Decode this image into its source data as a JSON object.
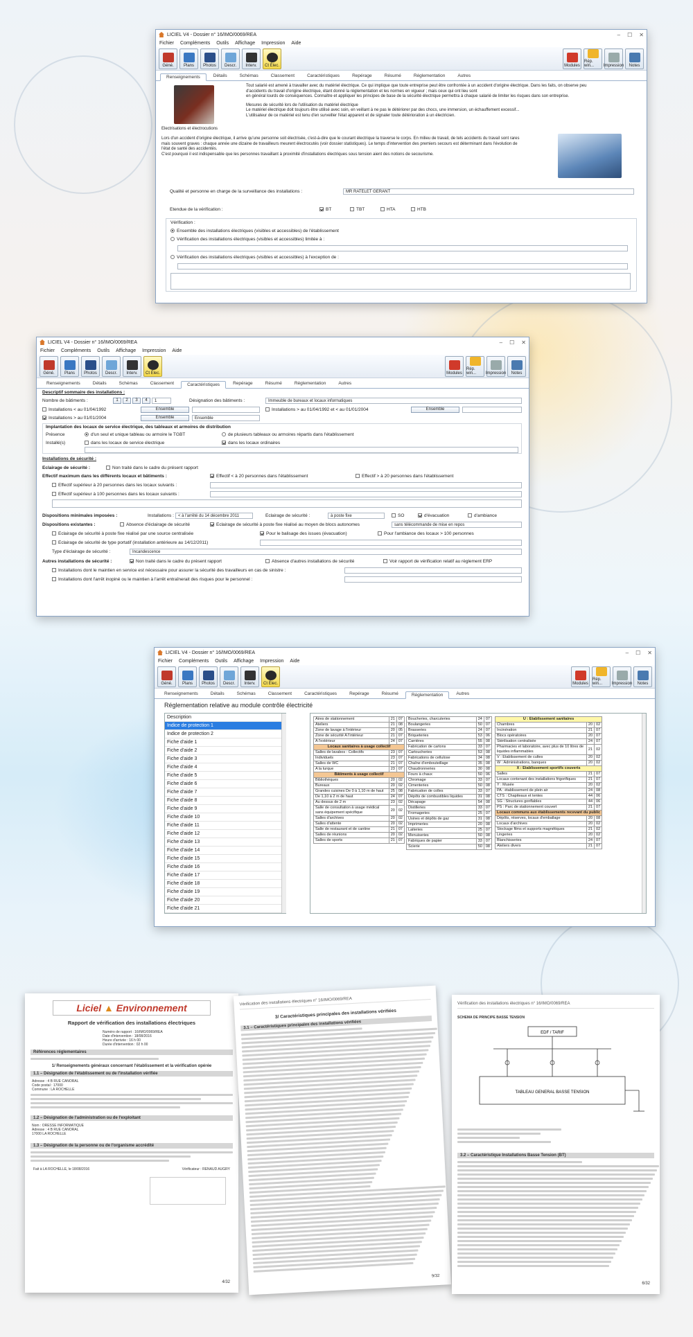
{
  "app": {
    "title": "LICIEL V4 - Dossier n° 16/IMO/0069/REA",
    "menu": [
      "Fichier",
      "Compléments",
      "Outils",
      "Affichage",
      "Impression",
      "Aide"
    ],
    "toolbar_left": [
      "Géné.",
      "Plans",
      "Photos",
      "Descr.",
      "Interv.",
      "Ct Élec."
    ],
    "toolbar_right": [
      "Modules",
      "Rép. win...",
      "Impression",
      "Notes"
    ],
    "tabs": [
      "Renseignements",
      "Détails",
      "Schémas",
      "Classement",
      "Caractéristiques",
      "Repérage",
      "Résumé",
      "Réglementation",
      "Autres"
    ]
  },
  "win1": {
    "intro_lines": [
      "Tout salarié est amené à travailler avec du matériel électrique. Ce qui implique que toute entreprise peut être confrontée à un accident d'origine électrique. Dans les faits, on observe peu",
      "d'accidents du travail d'origine électrique, étant donné la réglementation et les normes en vigueur ; mais ceux qui ont lieu sont",
      "en général lourds de conséquences. Connaître et appliquer les principes de base de la sécurité électrique permettra à chaque salarié de limiter les risques dans son entreprise."
    ],
    "measures_lines": [
      "Mesures de sécurité lors de l'utilisation du matériel électrique",
      "Le matériel électrique doit toujours être utilisé avec soin, en veillant à ne pas le détériorer par des chocs, une immersion, un échauffement excessif...",
      "L'utilisateur de ce matériel est tenu d'en surveiller l'état apparent et de signaler toute détérioration à un électricien."
    ],
    "heading": "Electrisations et électrocutions",
    "body_lines": [
      "Lors d'un accident d'origine électrique, il arrive qu'une personne soit électrisée, c'est-à-dire que le courant électrique la traverse le corps. En milieu de travail, de tels accidents du travail sont rares",
      "mais souvent graves : chaque année une dizaine de travailleurs meurent électrocutés (voir dossier statistiques). Le temps d'intervention des premiers secours est déterminant dans l'évolution de",
      "l'état de santé des accidentés.",
      "C'est pourquoi il est indispensable que les personnes travaillant à proximité d'installations électriques sous tension aient des notions de secourisme."
    ],
    "qualite_label": "Qualité et personne en charge de la surveillance des installations :",
    "qualite_value": "MR RATELET GERANT",
    "etendue_label": "Etendue de la vérification :",
    "etendue_opts": [
      "BT",
      "TBT",
      "HTA",
      "HTB"
    ],
    "verif_label": "Vérification :",
    "verif_opt1": "Ensemble des installations électriques (visibles et accessibles) de l'établissement",
    "verif_opt2": "Vérification des installations électriques (visibles et accessibles) limitée à :",
    "verif_opt3": "Vérification des installations électriques (visibles et accessibles) à l'exception de :"
  },
  "win2": {
    "desc_title": "Descriptif sommaire des installations :",
    "nb_bat": "Nombre de bâtiments :",
    "nb_buttons": [
      "1",
      "2",
      "3",
      "4"
    ],
    "nb_value": "1",
    "designation": "Désignation des bâtiments :",
    "designation_value": "Immeuble de bureaux et locaux informatiques",
    "inst_1992": "Installations < au 01/04/1992",
    "inst_1992b": "Installations > au 01/04/1992 et < au 01/01/2004",
    "inst_2004": "Installations > au 01/01/2004",
    "ensemble": "Ensemble",
    "implantation": "Implantation des locaux de service électrique, des tableaux et armoires de distribution",
    "presence": "Présence",
    "presence_opt1": "d'un seul et unique tableau ou armoire le TGBT",
    "presence_opt2": "de plusieurs tableaux ou armoires répartis dans l'établissement",
    "installs": "Installé(s)",
    "installs_opt1": "dans les locaux de service électrique",
    "installs_opt2": "dans les locaux ordinaires",
    "secu_title": "Installations de sécurité :",
    "eclairage": "Eclairage de sécurité :",
    "eclairage_opt": "Non traité dans le cadre du présent rapport",
    "effectif": "Effectif maximum dans les différents locaux et bâtiments :",
    "effectif_opt1": "Effectif < à 20 personnes dans l'établissement",
    "effectif_opt2": "Effectif > à 20 personnes dans l'établissement",
    "effectif_sub1": "Effectif supérieur à 20 personnes dans les locaux suivants :",
    "effectif_sub2": "Effectif supérieur à 100 personnes dans les locaux suivants :",
    "dispo_min": "Dispositions minimales imposées :",
    "dispo_inst": "Installations :",
    "dispo_inst_value": "< à l'arrêté du 14 décembre 2011",
    "dispo_eclair": "Eclairage de sécurité :",
    "dispo_eclair_value": "à poste fixe",
    "dispo_opts": [
      "SO",
      "d'évacuation",
      "d'ambiance"
    ],
    "dispo_exist": "Dispositions existantes :",
    "absence": "Absence d'éclairage de sécurité",
    "eclair_fixe": "Eclairage de sécurité à poste fixe réalisé au moyen de blocs autonomes",
    "telecommande": "sans télécommande de mise en repos",
    "eclair_centr": "Eclairage de sécurité à poste fixe réalisé par une source centralisée",
    "balisage": "Pour le balisage des issues (évacuation)",
    "ambiance": "Pour l'ambiance des locaux > 100 personnes",
    "portatif": "Eclairage de sécurité de type portatif (installation antérieure au 14/12/2011)",
    "type_eclair": "Type d'éclairage de sécurité :",
    "type_eclair_value": "Incandescence",
    "autres": "Autres installations de sécurité :",
    "autres_opt1": "Non traité dans le cadre du présent rapport",
    "autres_opt2": "Absence d'autres installations de sécurité",
    "autres_opt3": "Voir rapport de vérification relatif au règlement ERP",
    "autres_sub1": "Installations dont le maintien en service est nécessaire pour assurer la sécurité des travailleurs en cas de sinistre :",
    "autres_sub2": "Installations dont l'arrêt inopiné ou le maintien à l'arrêt entraînerait des risques pour le personnel :"
  },
  "win3": {
    "heading": "Réglementation relative au module contrôle électricité",
    "list": [
      "Description",
      "Indice de protection 1",
      "Indice de protection 2",
      "Fiche d'aide 1",
      "Fiche d'aide 2",
      "Fiche d'aide 3",
      "Fiche d'aide 4",
      "Fiche d'aide 5",
      "Fiche d'aide 6",
      "Fiche d'aide 7",
      "Fiche d'aide 8",
      "Fiche d'aide 9",
      "Fiche d'aide 10",
      "Fiche d'aide 11",
      "Fiche d'aide 12",
      "Fiche d'aide 13",
      "Fiche d'aide 14",
      "Fiche d'aide 15",
      "Fiche d'aide 16",
      "Fiche d'aide 17",
      "Fiche d'aide 18",
      "Fiche d'aide 19",
      "Fiche d'aide 20",
      "Fiche d'aide 21"
    ],
    "table_a": [
      [
        "Aires de stationnement",
        "21",
        "07"
      ],
      [
        "Ateliers",
        "21",
        "08"
      ],
      [
        "Zone de lavage à l'intérieur",
        "20",
        "05"
      ],
      [
        "Zone de sécurité A l'intérieur",
        "21",
        "07"
      ],
      [
        "A l'extérieur",
        "24",
        "07"
      ],
      [
        "#Locaux sanitaires à usage collectif"
      ],
      [
        "Salles de lavabos : Collectifs",
        "23",
        "07"
      ],
      [
        "Individuels",
        "23",
        "07"
      ],
      [
        "Salles de WC",
        "21",
        "07"
      ],
      [
        "A la turque",
        "23",
        "07"
      ],
      [
        "#Bâtiments à usage collectif"
      ],
      [
        "Bibliothèques",
        "20",
        "02"
      ],
      [
        "Bureaux",
        "20",
        "02"
      ],
      [
        "Grandes cuisines De 0 à 1,10 m de haut",
        "25",
        "08"
      ],
      [
        "De 1,10 à 2 m de haut",
        "24",
        "07"
      ],
      [
        "Au dessus de 2 m",
        "23",
        "02"
      ],
      [
        "Salle de consultation à usage médical sans équipement spécifique",
        "20",
        "02"
      ],
      [
        "Salles d'archives",
        "20",
        "02"
      ],
      [
        "Salles d'attente",
        "20",
        "02"
      ],
      [
        "Salle de restaurant et de cantine",
        "21",
        "07"
      ],
      [
        "Salles de réunions",
        "20",
        "02"
      ],
      [
        "Salles de sports",
        "21",
        "07"
      ]
    ],
    "table_b": [
      [
        "Boucheries, charcuteries",
        "24",
        "07"
      ],
      [
        "Boulangeries",
        "50",
        "07"
      ],
      [
        "Brasseries",
        "24",
        "07"
      ],
      [
        "Briqueteries",
        "53",
        "06"
      ],
      [
        "Carrières",
        "55",
        "08"
      ],
      [
        "Fabrication de cartons",
        "33",
        "07"
      ],
      [
        "Cartoucheries",
        "53",
        "08"
      ],
      [
        "Fabrications de cellulose",
        "34",
        "08"
      ],
      [
        "Chaîne d'embouteillage",
        "35",
        "08"
      ],
      [
        "Chaudronneries",
        "30",
        "08"
      ],
      [
        "Fours à chaux",
        "50",
        "06"
      ],
      [
        "Chromage",
        "33",
        "07"
      ],
      [
        "Cimenteries",
        "50",
        "08"
      ],
      [
        "Fabrication de colles",
        "33",
        "07"
      ],
      [
        "Dépôts de combustibles liquides",
        "31",
        "08"
      ],
      [
        "Décapage",
        "54",
        "08"
      ],
      [
        "Distilleries",
        "33",
        "07"
      ],
      [
        "Fromageries",
        "25",
        "07"
      ],
      [
        "Usines et dépôts de gaz",
        "31",
        "08"
      ],
      [
        "Imprimeries",
        "20",
        "08"
      ],
      [
        "Laiteries",
        "25",
        "07"
      ],
      [
        "Menuiseries",
        "50",
        "08"
      ],
      [
        "Fabriques de papier",
        "33",
        "07"
      ],
      [
        "Scierie",
        "50",
        "08"
      ]
    ],
    "table_c": [
      [
        "%U : Etablissement sanitaires"
      ],
      [
        "Chambres",
        "20",
        "02"
      ],
      [
        "Incinération",
        "21",
        "07"
      ],
      [
        "Blocs opératoires",
        "20",
        "07"
      ],
      [
        "Stérilisation centralisée",
        "24",
        "07"
      ],
      [
        "Pharmacies et laboratoire, avec plus de 10 litres de liquides inflammables",
        "21",
        "02"
      ],
      [
        "V : Etablissement de cultes",
        "20",
        "02"
      ],
      [
        "W : Administrations, banques",
        "20",
        "02"
      ],
      [
        "%X : Etablissement sportifs couverts"
      ],
      [
        "Salles",
        "21",
        "07"
      ],
      [
        "Locaux contenant des installations frigorifiques",
        "21",
        "07"
      ],
      [
        "Y : Musée",
        "20",
        "02"
      ],
      [
        "PA : établissement de plein air",
        "24",
        "08"
      ],
      [
        "CTS : Chapiteaux et tentes",
        "44",
        "06"
      ],
      [
        "SG : Structures gonflables",
        "44",
        "06"
      ],
      [
        "PS : Parc de stationnement couvert",
        "21",
        "07"
      ],
      [
        "#Locaux communs aux établissements recevant du public"
      ],
      [
        "Dépôts, réserves, locaux d'emballage",
        "20",
        "08"
      ],
      [
        "Locaux d'archives",
        "20",
        "02"
      ],
      [
        "Stockage films et supports magnétiques",
        "21",
        "02"
      ],
      [
        "Lingeries",
        "20",
        "02"
      ],
      [
        "Blanchisseries",
        "24",
        "07"
      ],
      [
        "Ateliers divers",
        "21",
        "07"
      ]
    ]
  },
  "papers": {
    "p1_brand_a": "Liciel",
    "p1_brand_b": "Environnement",
    "p1_title": "Rapport de vérification des installations électriques",
    "p1_fields": [
      "Numéro de rapport : 16/IMO/0069/REA",
      "Date d'intervention : 18/08/2016",
      "Heure d'arrivée : 16 h 00",
      "Durée d'intervention : 02 h 00"
    ],
    "p1_ref": "Références réglementaires",
    "p1_s1": "1/ Renseignements généraux concernant l'établissement et la vérification opérée",
    "p1_s11": "1.1 – Désignation de l'établissement ou de l'installation vérifiée",
    "p1_s12": "1.2 – Désignation de l'administration ou de l'exploitant",
    "p1_s13": "1.3 – Désignation de la personne ou de l'organisme accrédité",
    "p1_lines": [
      "Adresse : 4 B RUE CANORAL",
      "Code postal : 17000",
      "Commune : LA ROCHELLE",
      "Nom : ORESSE INFORMATIQUE",
      "Adresse : 4 B RUE CANORAL",
      "17000 LA ROCHELLE"
    ],
    "p1_sign": "Fait à LA ROCHELLE, le 18/08/2016",
    "p1_verif": "Vérificateur : RENAUD AUGRY",
    "p1_page": "4/32",
    "p2_header": "Vérification des installations électriques n° 16/IMO/0069/REA",
    "p2_title": "3/ Caractéristiques principales des installations vérifiées",
    "p2_sub": "3.1 – Caractéristiques principales des installations vérifiées",
    "p2_page": "9/32",
    "p3_header": "Vérification des installations électriques n° 16/IMO/0069/REA",
    "p3_schema": "SCHEMA DE PRINCIPE BASSE TENSION",
    "p3_edf": "EDF / TARIF",
    "p3_tgbt": "TABLEAU GENERAL BASSE TENSION",
    "p3_sec": "3.2 – Caractéristique Installations Basse Tension (BT)",
    "p3_page": "6/32"
  }
}
